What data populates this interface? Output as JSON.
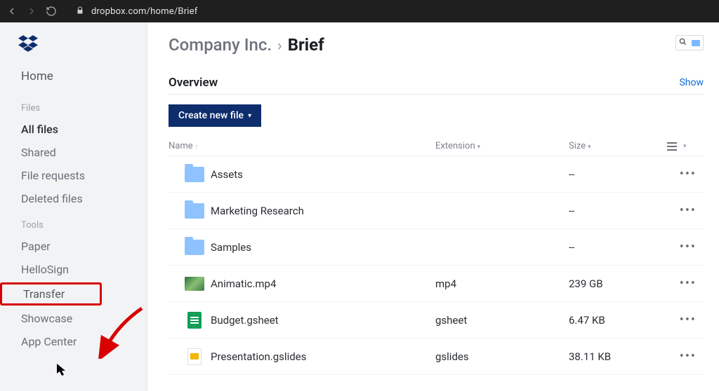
{
  "browser": {
    "url": "dropbox.com/home/Brief"
  },
  "sidebar": {
    "home": "Home",
    "section_files": "Files",
    "files": [
      "All files",
      "Shared",
      "File requests",
      "Deleted files"
    ],
    "section_tools": "Tools",
    "tools": [
      "Paper",
      "HelloSign",
      "Transfer",
      "Showcase",
      "App Center"
    ]
  },
  "breadcrumb": {
    "parent": "Company Inc.",
    "sep": "›",
    "current": "Brief"
  },
  "overview": {
    "title": "Overview",
    "show": "Show"
  },
  "actions": {
    "create": "Create new file"
  },
  "columns": {
    "name": "Name",
    "extension": "Extension",
    "size": "Size"
  },
  "rows": [
    {
      "type": "folder",
      "name": "Assets",
      "ext": "",
      "size": "--"
    },
    {
      "type": "folder",
      "name": "Marketing Research",
      "ext": "",
      "size": "--"
    },
    {
      "type": "folder",
      "name": "Samples",
      "ext": "",
      "size": "--"
    },
    {
      "type": "video",
      "name": "Animatic.mp4",
      "ext": "mp4",
      "size": "239 GB"
    },
    {
      "type": "sheet",
      "name": "Budget.gsheet",
      "ext": "gsheet",
      "size": "6.47 KB"
    },
    {
      "type": "slides",
      "name": "Presentation.gslides",
      "ext": "gslides",
      "size": "38.11 KB"
    }
  ],
  "annotation": {
    "highlight_tool_index": 2
  }
}
